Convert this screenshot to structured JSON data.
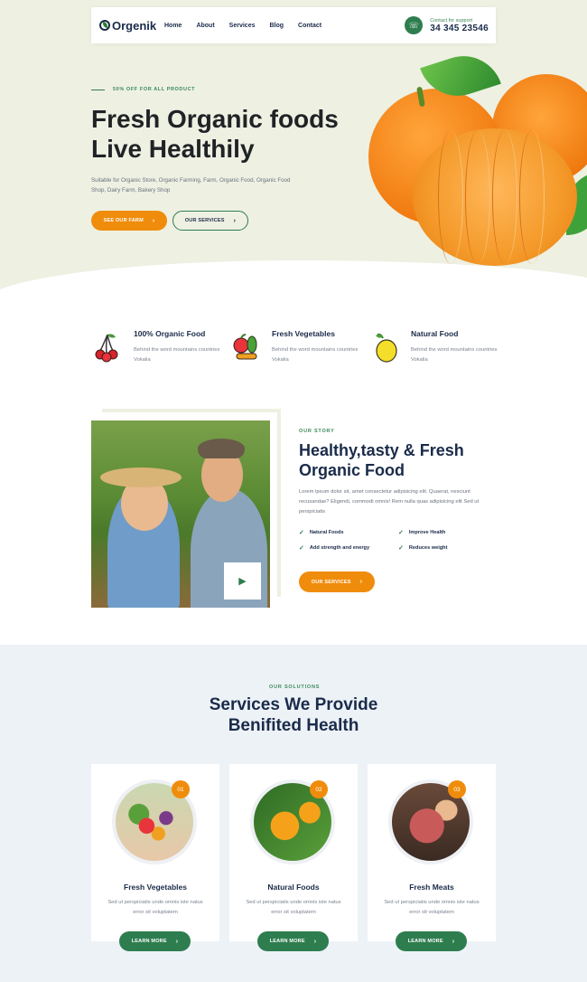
{
  "header": {
    "logo": "Orgenik",
    "nav": [
      "Home",
      "About",
      "Services",
      "Blog",
      "Contact"
    ],
    "support_label": "Contact for support",
    "support_phone": "34 345 23546"
  },
  "hero": {
    "tag": "50% OFF FOR ALL PRODUCT",
    "title_line1": "Fresh Organic foods",
    "title_line2": "Live Healthily",
    "description": "Suitable for Organic Store, Organic Farming, Farm, Organic Food, Organic Food Shop, Dairy Farm, Bakery Shop",
    "btn_primary": "SEE OUR FARM",
    "btn_secondary": "OUR SERVICES"
  },
  "features": [
    {
      "title": "100% Organic Food",
      "text": "Behind the word mountains countries Vokalia",
      "icon": "cherries-icon"
    },
    {
      "title": "Fresh Vegetables",
      "text": "Behind the word mountains countries Vokalia",
      "icon": "vegetables-icon"
    },
    {
      "title": "Natural Food",
      "text": "Behind the word mountains countries Vokalia",
      "icon": "lemon-icon"
    }
  ],
  "story": {
    "tag": "OUR STORY",
    "title": "Healthy,tasty & Fresh Organic Food",
    "description": "Lorem ipsum dolor sit, amet consectetur adipisicing elit. Quaerat, nesciunt recusandae? Eligendi, commodi omnis! Rem nulla quas adipisicing elit Sed ut perspiciatis",
    "checks": [
      "Natural Foods",
      "Improve Health",
      "Add strength and energy",
      "Reduces weight"
    ],
    "button": "OUR SERVICES"
  },
  "services": {
    "tag": "OUR SOLUTIONS",
    "title_line1": "Services We Provide",
    "title_line2": "Benifited Health",
    "cards": [
      {
        "num": "01",
        "title": "Fresh Vegetables",
        "text": "Sed ut perspiciatis unde omnis iste natus error sit voluptatem",
        "button": "LEARN MORE"
      },
      {
        "num": "02",
        "title": "Natural Foods",
        "text": "Sed ut perspiciatis unde omnis iste natus error sit voluptatem",
        "button": "LEARN MORE"
      },
      {
        "num": "03",
        "title": "Fresh Meats",
        "text": "Sed ut perspiciatis unde omnis iste natus error sit voluptatem",
        "button": "LEARN MORE"
      }
    ]
  },
  "colors": {
    "accent": "#f08c0c",
    "green": "#2e7d4f",
    "navy": "#1a2b4a",
    "hero_bg": "#eef0e2",
    "services_bg": "#edf2f7"
  }
}
